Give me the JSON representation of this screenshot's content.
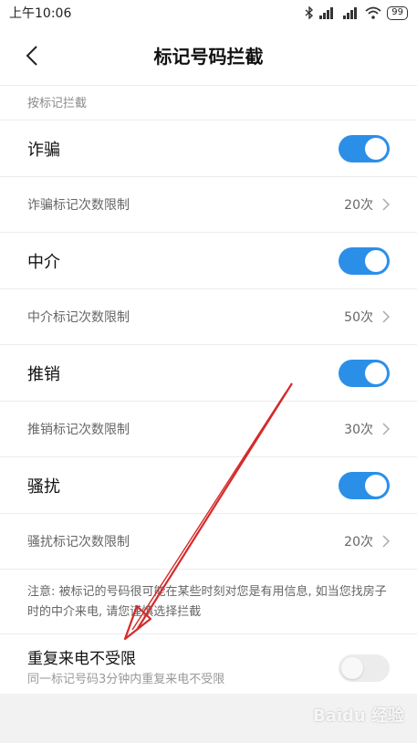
{
  "status_bar": {
    "time": "上午10:06",
    "battery": "99"
  },
  "header": {
    "title": "标记号码拦截"
  },
  "section": {
    "label": "按标记拦截"
  },
  "categories": [
    {
      "label": "诈骗",
      "enabled": true,
      "limit_label": "诈骗标记次数限制",
      "limit_value": "20次"
    },
    {
      "label": "中介",
      "enabled": true,
      "limit_label": "中介标记次数限制",
      "limit_value": "50次"
    },
    {
      "label": "推销",
      "enabled": true,
      "limit_label": "推销标记次数限制",
      "limit_value": "30次"
    },
    {
      "label": "骚扰",
      "enabled": true,
      "limit_label": "骚扰标记次数限制",
      "limit_value": "20次"
    }
  ],
  "note": "注意: 被标记的号码很可能在某些时刻对您是有用信息, 如当您找房子时的中介来电, 请您谨慎选择拦截",
  "repeat_call": {
    "title": "重复来电不受限",
    "subtitle": "同一标记号码3分钟内重复来电不受限",
    "enabled": false
  },
  "watermark": "Baidu 经验",
  "colors": {
    "accent": "#2b8fe8",
    "annotation_arrow": "#d42a2a"
  }
}
